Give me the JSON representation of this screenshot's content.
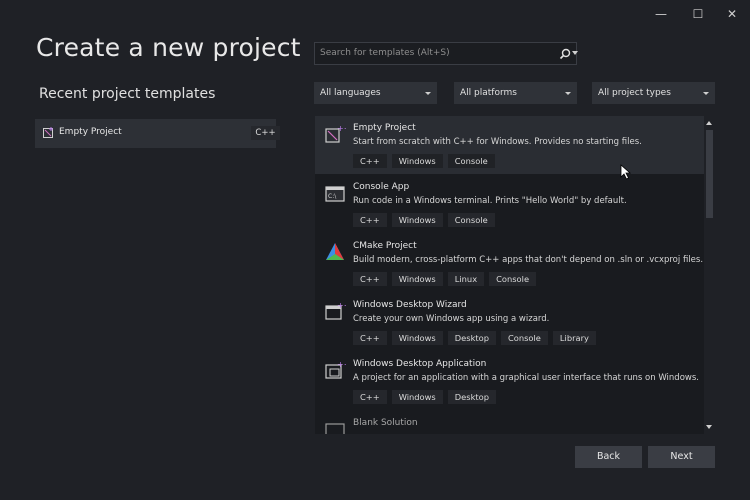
{
  "window_controls": {
    "minimize": "—",
    "maximize": "☐",
    "close": "✕"
  },
  "page": {
    "title": "Create a new project"
  },
  "recent": {
    "heading": "Recent project templates",
    "items": [
      {
        "name": "Empty Project",
        "lang": "C++",
        "icon": "empty-project-icon"
      }
    ]
  },
  "search": {
    "placeholder": "Search for templates (Alt+S)",
    "icon": "search-icon"
  },
  "filters": {
    "languages": "All languages",
    "platforms": "All platforms",
    "project_types": "All project types"
  },
  "templates": [
    {
      "name": "Empty Project",
      "desc": "Start from scratch with C++ for Windows. Provides no starting files.",
      "tags": [
        "C++",
        "Windows",
        "Console"
      ],
      "selected": true,
      "icon": "empty-project-icon"
    },
    {
      "name": "Console App",
      "desc": "Run code in a Windows terminal. Prints \"Hello World\" by default.",
      "tags": [
        "C++",
        "Windows",
        "Console"
      ],
      "icon": "console-app-icon"
    },
    {
      "name": "CMake Project",
      "desc": "Build modern, cross-platform C++ apps that don't depend on .sln or .vcxproj files.",
      "tags": [
        "C++",
        "Windows",
        "Linux",
        "Console"
      ],
      "icon": "cmake-icon"
    },
    {
      "name": "Windows Desktop Wizard",
      "desc": "Create your own Windows app using a wizard.",
      "tags": [
        "C++",
        "Windows",
        "Desktop",
        "Console",
        "Library"
      ],
      "icon": "desktop-wizard-icon"
    },
    {
      "name": "Windows Desktop Application",
      "desc": "A project for an application with a graphical user interface that runs on Windows.",
      "tags": [
        "C++",
        "Windows",
        "Desktop"
      ],
      "icon": "desktop-app-icon"
    },
    {
      "name": "Blank Solution",
      "desc": "",
      "tags": [],
      "icon": "blank-solution-icon"
    }
  ],
  "buttons": {
    "back": "Back",
    "next": "Next"
  },
  "colors": {
    "background": "#1f2126",
    "list_bg": "#191b1f",
    "selected_row": "#2a2d33",
    "button": "#3a3d44",
    "accent_purple": "#b77be3"
  }
}
